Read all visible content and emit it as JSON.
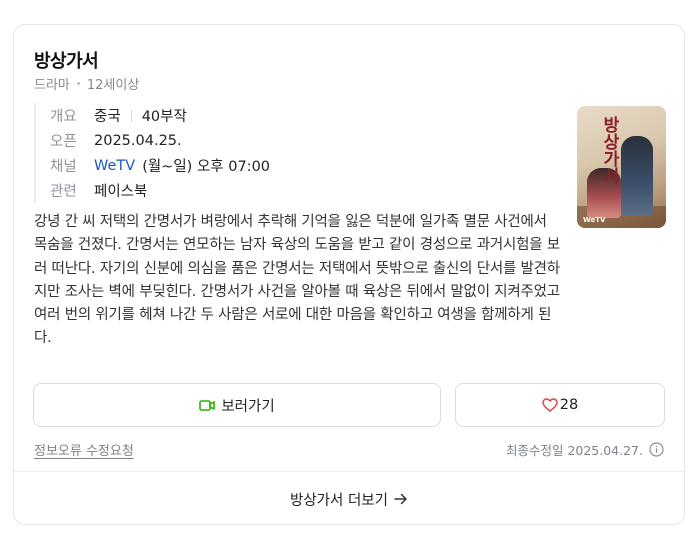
{
  "title": "방상가서",
  "sub": {
    "genre": "드라마",
    "rating": "12세이상"
  },
  "info": {
    "overview": {
      "label": "개요",
      "country": "중국",
      "episodes": "40부작"
    },
    "open": {
      "label": "오픈",
      "date": "2025.04.25."
    },
    "channel": {
      "label": "채널",
      "name": "WeTV",
      "time": "(월~일) 오후 07:00"
    },
    "related": {
      "label": "관련",
      "link": "페이스북"
    }
  },
  "poster": {
    "title_text": "방상가서",
    "watermark": "WeTV"
  },
  "description": "강녕 간 씨 저택의 간명서가 벼랑에서 추락해 기억을 잃은 덕분에 일가족 멸문 사건에서 목숨을 건졌다. 간명서는 연모하는 남자 육상의 도움을 받고 같이 경성으로 과거시험을 보러 떠난다. 자기의 신분에 의심을 품은 간명서는 저택에서 뜻밖으로 출신의 단서를 발견하지만 조사는 벽에 부딪힌다. 간명서가 사건을 알아볼 때 육상은 뒤에서 말없이 지켜주었고 여러 번의 위기를 헤쳐 나간 두 사람은 서로에 대한 마음을 확인하고 여생을 함께하게 된다.",
  "buttons": {
    "watch": "보러가기",
    "like_count": "28"
  },
  "footer": {
    "report": "정보오류 수정요청",
    "updated": "최종수정일 2025.04.27."
  },
  "more": "방상가서 더보기",
  "colors": {
    "link": "#1d5bbf",
    "watch_icon": "#2db400",
    "heart": "#e0424a"
  }
}
